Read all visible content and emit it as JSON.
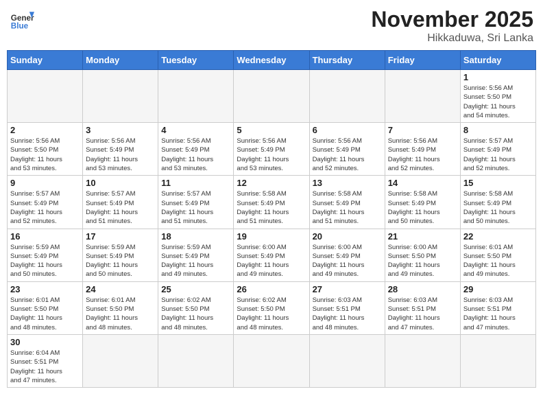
{
  "header": {
    "logo_general": "General",
    "logo_blue": "Blue",
    "month_title": "November 2025",
    "location": "Hikkaduwa, Sri Lanka"
  },
  "weekdays": [
    "Sunday",
    "Monday",
    "Tuesday",
    "Wednesday",
    "Thursday",
    "Friday",
    "Saturday"
  ],
  "weeks": [
    [
      {
        "day": "",
        "info": ""
      },
      {
        "day": "",
        "info": ""
      },
      {
        "day": "",
        "info": ""
      },
      {
        "day": "",
        "info": ""
      },
      {
        "day": "",
        "info": ""
      },
      {
        "day": "",
        "info": ""
      },
      {
        "day": "1",
        "info": "Sunrise: 5:56 AM\nSunset: 5:50 PM\nDaylight: 11 hours\nand 54 minutes."
      }
    ],
    [
      {
        "day": "2",
        "info": "Sunrise: 5:56 AM\nSunset: 5:50 PM\nDaylight: 11 hours\nand 53 minutes."
      },
      {
        "day": "3",
        "info": "Sunrise: 5:56 AM\nSunset: 5:49 PM\nDaylight: 11 hours\nand 53 minutes."
      },
      {
        "day": "4",
        "info": "Sunrise: 5:56 AM\nSunset: 5:49 PM\nDaylight: 11 hours\nand 53 minutes."
      },
      {
        "day": "5",
        "info": "Sunrise: 5:56 AM\nSunset: 5:49 PM\nDaylight: 11 hours\nand 53 minutes."
      },
      {
        "day": "6",
        "info": "Sunrise: 5:56 AM\nSunset: 5:49 PM\nDaylight: 11 hours\nand 52 minutes."
      },
      {
        "day": "7",
        "info": "Sunrise: 5:56 AM\nSunset: 5:49 PM\nDaylight: 11 hours\nand 52 minutes."
      },
      {
        "day": "8",
        "info": "Sunrise: 5:57 AM\nSunset: 5:49 PM\nDaylight: 11 hours\nand 52 minutes."
      }
    ],
    [
      {
        "day": "9",
        "info": "Sunrise: 5:57 AM\nSunset: 5:49 PM\nDaylight: 11 hours\nand 52 minutes."
      },
      {
        "day": "10",
        "info": "Sunrise: 5:57 AM\nSunset: 5:49 PM\nDaylight: 11 hours\nand 51 minutes."
      },
      {
        "day": "11",
        "info": "Sunrise: 5:57 AM\nSunset: 5:49 PM\nDaylight: 11 hours\nand 51 minutes."
      },
      {
        "day": "12",
        "info": "Sunrise: 5:58 AM\nSunset: 5:49 PM\nDaylight: 11 hours\nand 51 minutes."
      },
      {
        "day": "13",
        "info": "Sunrise: 5:58 AM\nSunset: 5:49 PM\nDaylight: 11 hours\nand 51 minutes."
      },
      {
        "day": "14",
        "info": "Sunrise: 5:58 AM\nSunset: 5:49 PM\nDaylight: 11 hours\nand 50 minutes."
      },
      {
        "day": "15",
        "info": "Sunrise: 5:58 AM\nSunset: 5:49 PM\nDaylight: 11 hours\nand 50 minutes."
      }
    ],
    [
      {
        "day": "16",
        "info": "Sunrise: 5:59 AM\nSunset: 5:49 PM\nDaylight: 11 hours\nand 50 minutes."
      },
      {
        "day": "17",
        "info": "Sunrise: 5:59 AM\nSunset: 5:49 PM\nDaylight: 11 hours\nand 50 minutes."
      },
      {
        "day": "18",
        "info": "Sunrise: 5:59 AM\nSunset: 5:49 PM\nDaylight: 11 hours\nand 49 minutes."
      },
      {
        "day": "19",
        "info": "Sunrise: 6:00 AM\nSunset: 5:49 PM\nDaylight: 11 hours\nand 49 minutes."
      },
      {
        "day": "20",
        "info": "Sunrise: 6:00 AM\nSunset: 5:49 PM\nDaylight: 11 hours\nand 49 minutes."
      },
      {
        "day": "21",
        "info": "Sunrise: 6:00 AM\nSunset: 5:50 PM\nDaylight: 11 hours\nand 49 minutes."
      },
      {
        "day": "22",
        "info": "Sunrise: 6:01 AM\nSunset: 5:50 PM\nDaylight: 11 hours\nand 49 minutes."
      }
    ],
    [
      {
        "day": "23",
        "info": "Sunrise: 6:01 AM\nSunset: 5:50 PM\nDaylight: 11 hours\nand 48 minutes."
      },
      {
        "day": "24",
        "info": "Sunrise: 6:01 AM\nSunset: 5:50 PM\nDaylight: 11 hours\nand 48 minutes."
      },
      {
        "day": "25",
        "info": "Sunrise: 6:02 AM\nSunset: 5:50 PM\nDaylight: 11 hours\nand 48 minutes."
      },
      {
        "day": "26",
        "info": "Sunrise: 6:02 AM\nSunset: 5:50 PM\nDaylight: 11 hours\nand 48 minutes."
      },
      {
        "day": "27",
        "info": "Sunrise: 6:03 AM\nSunset: 5:51 PM\nDaylight: 11 hours\nand 48 minutes."
      },
      {
        "day": "28",
        "info": "Sunrise: 6:03 AM\nSunset: 5:51 PM\nDaylight: 11 hours\nand 47 minutes."
      },
      {
        "day": "29",
        "info": "Sunrise: 6:03 AM\nSunset: 5:51 PM\nDaylight: 11 hours\nand 47 minutes."
      }
    ],
    [
      {
        "day": "30",
        "info": "Sunrise: 6:04 AM\nSunset: 5:51 PM\nDaylight: 11 hours\nand 47 minutes."
      },
      {
        "day": "",
        "info": ""
      },
      {
        "day": "",
        "info": ""
      },
      {
        "day": "",
        "info": ""
      },
      {
        "day": "",
        "info": ""
      },
      {
        "day": "",
        "info": ""
      },
      {
        "day": "",
        "info": ""
      }
    ]
  ]
}
